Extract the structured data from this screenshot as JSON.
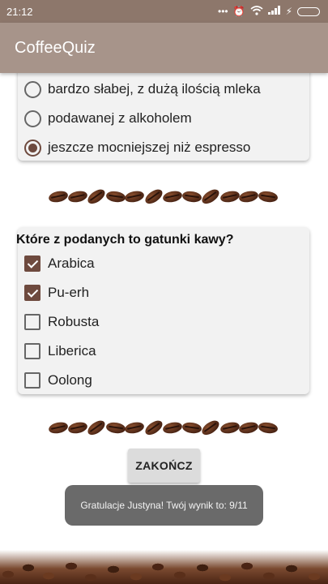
{
  "status_bar": {
    "time": "21:12",
    "icons": [
      "more-icon",
      "alarm-icon",
      "wifi-icon",
      "signal-icon",
      "charging-icon",
      "battery-icon"
    ]
  },
  "app_bar": {
    "title": "CoffeeQuiz"
  },
  "question1": {
    "options": [
      {
        "label": "bardzo słabej, z dużą ilością mleka",
        "checked": false
      },
      {
        "label": "podawanej z alkoholem",
        "checked": false
      },
      {
        "label": "jeszcze mocniejszej niż espresso",
        "checked": true
      }
    ]
  },
  "question2": {
    "title": "Które z podanych to gatunki kawy?",
    "options": [
      {
        "label": "Arabica",
        "checked": true
      },
      {
        "label": "Pu-erh",
        "checked": true
      },
      {
        "label": "Robusta",
        "checked": false
      },
      {
        "label": "Liberica",
        "checked": false
      },
      {
        "label": "Oolong",
        "checked": false
      }
    ]
  },
  "finish_button": {
    "label": "ZAKOŃCZ"
  },
  "toast": {
    "message": "Gratulacje Justyna! Twój wynik to: 9/11"
  },
  "colors": {
    "accent": "#6e4a3e",
    "app_bar": "#a7948a",
    "status_bar": "#8d776b"
  }
}
